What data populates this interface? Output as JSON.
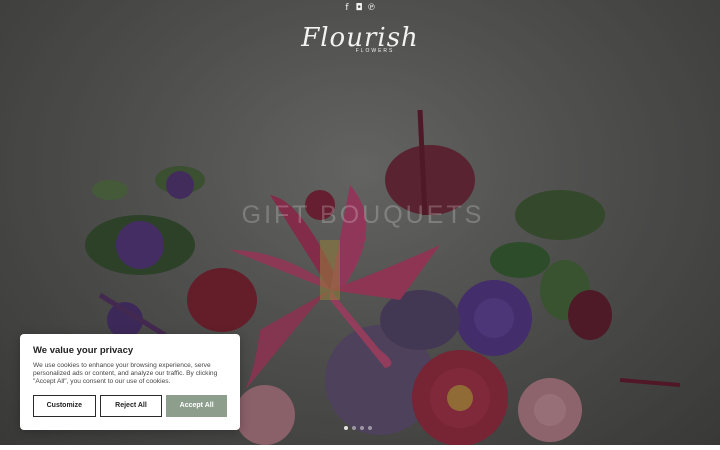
{
  "header": {
    "social": [
      {
        "icon": "facebook-icon",
        "glyph": "f"
      },
      {
        "icon": "instagram-icon",
        "glyph": "◘"
      },
      {
        "icon": "pinterest-icon",
        "glyph": "℗"
      }
    ],
    "logo": {
      "script": "Flourish",
      "sub": "FLOWERS"
    }
  },
  "hero": {
    "watermark": "GIFT BOUQUETS",
    "slides": 4,
    "active_slide": 1
  },
  "cookie_banner": {
    "title": "We value your privacy",
    "body": "We use cookies to enhance your browsing experience, serve personalized ads or content, and analyze our traffic. By clicking \"Accept All\", you consent to our use of cookies.",
    "buttons": {
      "customize": "Customize",
      "reject": "Reject All",
      "accept": "Accept All"
    },
    "accent": "#8d9e8d"
  }
}
